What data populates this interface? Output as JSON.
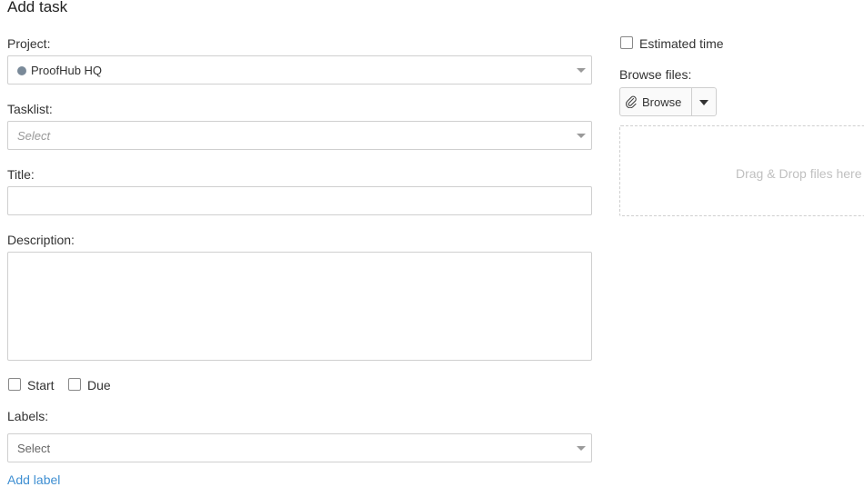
{
  "title": "Add task",
  "project": {
    "label": "Project:",
    "value": "ProofHub HQ",
    "dot_color": "#7a8a99"
  },
  "tasklist": {
    "label": "Tasklist:",
    "placeholder": "Select"
  },
  "title_field": {
    "label": "Title:",
    "value": ""
  },
  "description": {
    "label": "Description:",
    "value": ""
  },
  "dates": {
    "start_label": "Start",
    "due_label": "Due",
    "start_checked": false,
    "due_checked": false
  },
  "labels": {
    "label": "Labels:",
    "placeholder": "Select",
    "add_label": "Add label"
  },
  "estimated_time": {
    "label": "Estimated time",
    "checked": false
  },
  "browse_files": {
    "label": "Browse files:",
    "button": "Browse",
    "icon": "paperclip-icon",
    "dropzone_text": "Drag & Drop files here"
  },
  "colors": {
    "link": "#3f8fd2",
    "border": "#cfcfcf"
  }
}
